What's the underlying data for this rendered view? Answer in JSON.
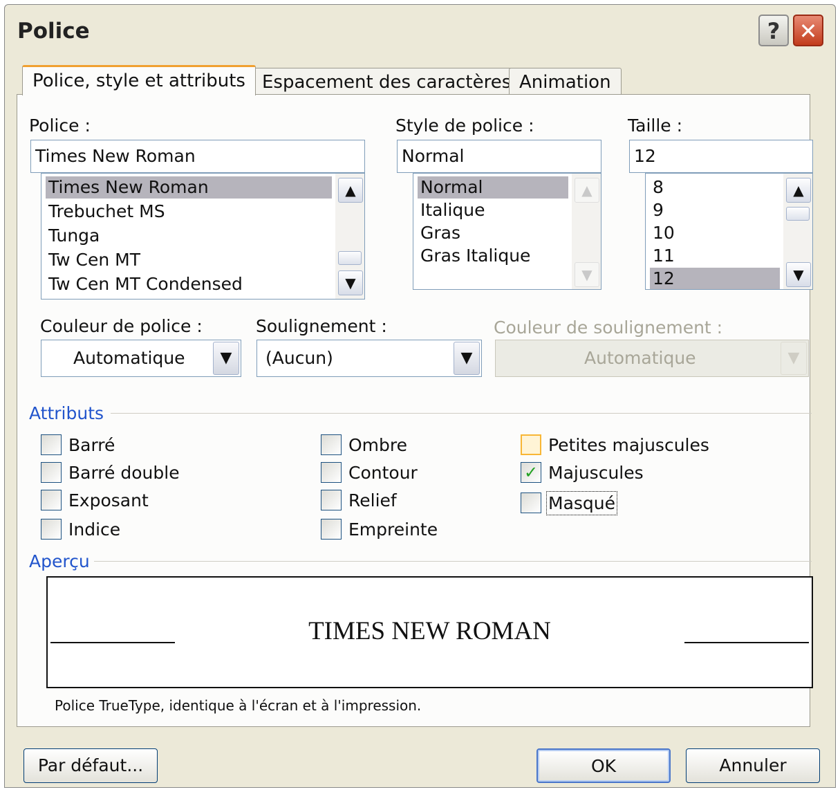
{
  "window": {
    "title": "Police",
    "help_icon": "?",
    "close_icon": "✕"
  },
  "tabs": [
    {
      "label": "Police, style et attributs",
      "active": true
    },
    {
      "label": "Espacement des caractères",
      "active": false
    },
    {
      "label": "Animation",
      "active": false
    }
  ],
  "font": {
    "label": "Police :",
    "value": "Times New Roman",
    "items": [
      "Times New Roman",
      "Trebuchet MS",
      "Tunga",
      "Tw Cen MT",
      "Tw Cen MT Condensed"
    ],
    "selected": "Times New Roman"
  },
  "style": {
    "label": "Style de police :",
    "value": "Normal",
    "items": [
      "Normal",
      "Italique",
      "Gras",
      "Gras Italique"
    ],
    "selected": "Normal"
  },
  "size": {
    "label": "Taille :",
    "value": "12",
    "items": [
      "8",
      "9",
      "10",
      "11",
      "12"
    ],
    "selected": "12"
  },
  "color": {
    "label": "Couleur de police :",
    "value": "Automatique"
  },
  "underline": {
    "label": "Soulignement :",
    "value": "(Aucun)"
  },
  "underline_color": {
    "label": "Couleur de soulignement :",
    "value": "Automatique",
    "disabled": true
  },
  "attributes": {
    "title": "Attributs",
    "col1": [
      {
        "label": "Barré",
        "checked": false
      },
      {
        "label": "Barré double",
        "checked": false
      },
      {
        "label": "Exposant",
        "checked": false
      },
      {
        "label": "Indice",
        "checked": false
      }
    ],
    "col2": [
      {
        "label": "Ombre",
        "checked": false
      },
      {
        "label": "Contour",
        "checked": false
      },
      {
        "label": "Relief",
        "checked": false
      },
      {
        "label": "Empreinte",
        "checked": false
      }
    ],
    "col3": [
      {
        "label": "Petites majuscules",
        "checked": false
      },
      {
        "label": "Majuscules",
        "checked": true
      },
      {
        "label": "Masqué",
        "checked": false
      }
    ],
    "check_glyph": "✓"
  },
  "preview": {
    "title": "Aperçu",
    "text": "TIMES NEW ROMAN",
    "note": "Police TrueType, identique à l'écran et à l'impression."
  },
  "buttons": {
    "default": "Par défaut...",
    "ok": "OK",
    "cancel": "Annuler"
  },
  "scroll_glyphs": {
    "up": "▲",
    "down": "▼",
    "dropdown": "▼"
  }
}
